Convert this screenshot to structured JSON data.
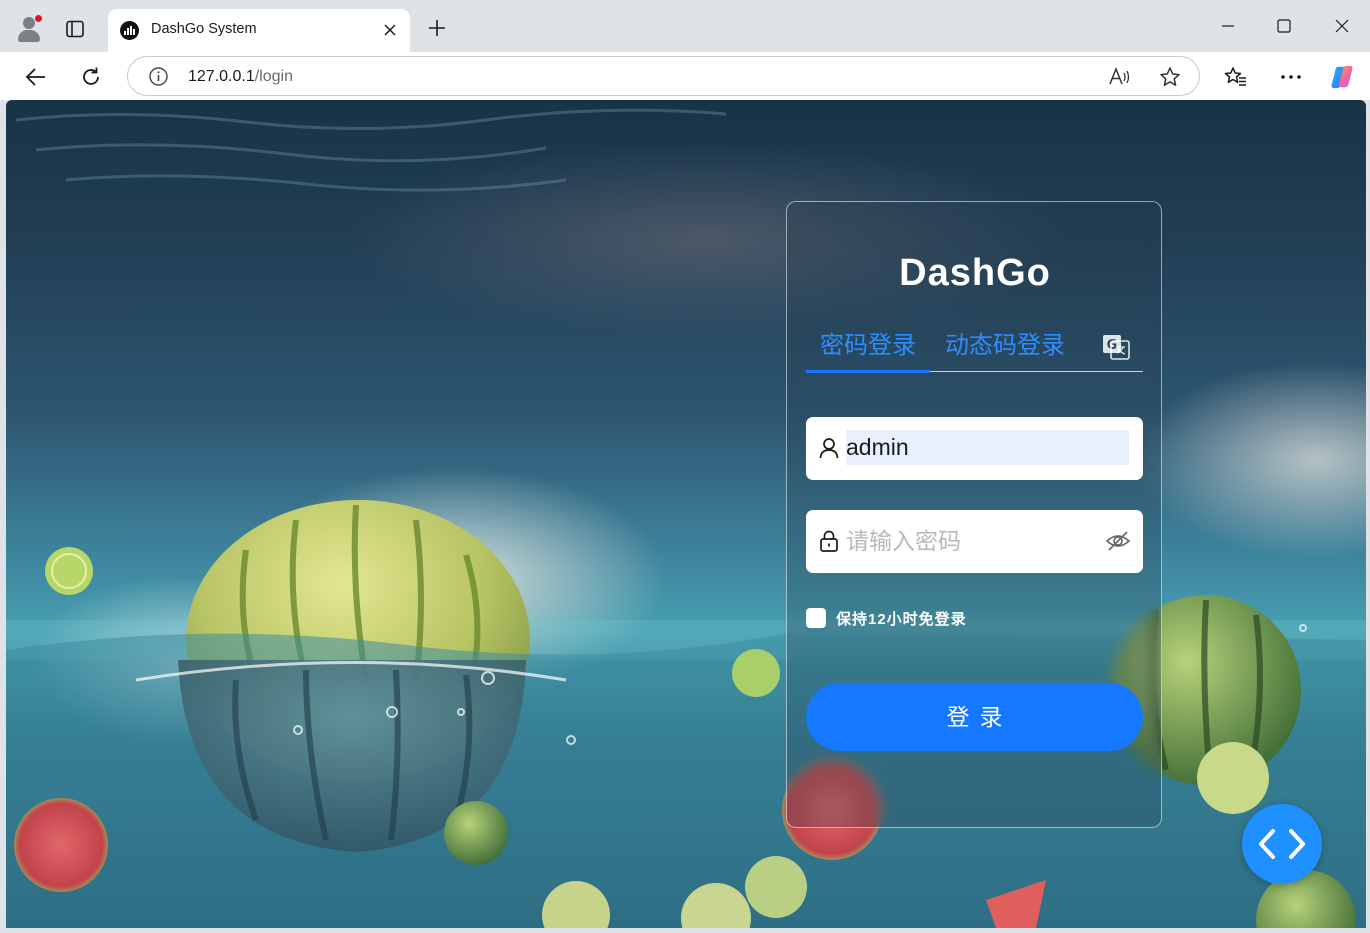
{
  "browser": {
    "tab_title": "DashGo System",
    "url_host": "127.0.0.1",
    "url_path": "/login"
  },
  "login": {
    "title": "DashGo",
    "tabs": [
      {
        "label": "密码登录",
        "active": true
      },
      {
        "label": "动态码登录",
        "active": false
      }
    ],
    "username_value": "admin",
    "password_placeholder": "请输入密码",
    "remember_label": "保持12小时免登录",
    "remember_checked": false,
    "submit_label": "登录"
  },
  "icons": {
    "profile": "profile-avatar-icon",
    "tabs": "vertical-tabs-icon",
    "favicon": "dashgo-favicon-icon",
    "close": "close-icon",
    "new_tab": "plus-icon",
    "minimize": "minimize-icon",
    "maximize": "maximize-icon",
    "window_close": "window-close-icon",
    "back": "back-arrow-icon",
    "refresh": "refresh-icon",
    "site_info": "info-icon",
    "read_aloud": "read-aloud-icon",
    "favorite": "star-icon",
    "favorites_list": "favorites-icon",
    "more": "more-icon",
    "copilot": "copilot-icon",
    "language": "translate-icon",
    "user": "user-icon",
    "lock": "lock-icon",
    "eye_off": "eye-off-icon",
    "dev_tools": "code-icon"
  },
  "colors": {
    "accent": "#1677ff",
    "tab_text": "#2f8cff",
    "autofill_bg": "#e8f0fe"
  }
}
